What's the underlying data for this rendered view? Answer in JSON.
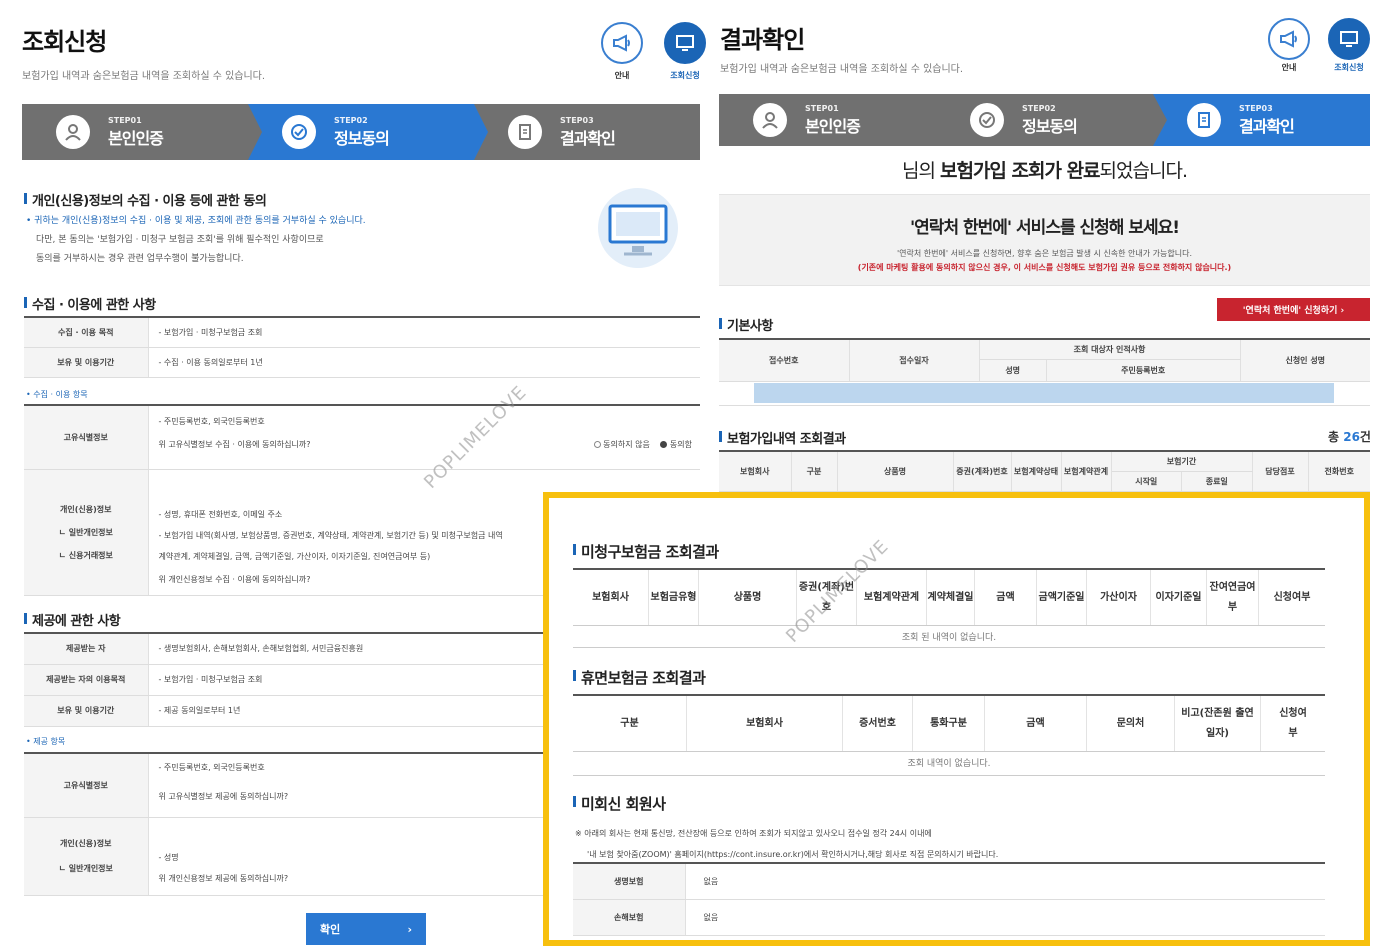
{
  "left": {
    "title": "조회신청",
    "subtitle": "보험가입 내역과 숨은보험금 내역을 조회하실 수 있습니다.",
    "btn_guide": "안내",
    "btn_inquiry": "조회신청",
    "steps": [
      {
        "no": "STEP01",
        "name": "본인인증"
      },
      {
        "no": "STEP02",
        "name": "정보동의"
      },
      {
        "no": "STEP03",
        "name": "결과확인"
      }
    ],
    "consent_title": "개인(신용)정보의 수집 · 이용 등에 관한 동의",
    "consent_lines": [
      "• 귀하는 개인(신용)정보의 수집 · 이용 및 제공, 조회에 관한 동의를 거부하실 수 있습니다.",
      "다만, 본 동의는 '보험가입 · 미청구 보험금 조회'를 위해 필수적인 사항이므로",
      "동의를 거부하시는 경우 관련 업무수행이 불가능합니다."
    ],
    "collect_title": "수집 · 이용에 관한 사항",
    "collect_rows": [
      {
        "label": "수집 · 이용 목적",
        "value": "- 보험가입 · 미청구보험금 조회"
      },
      {
        "label": "보유 및 이용기간",
        "value": "- 수집 · 이용 동의일로부터 1년"
      }
    ],
    "collect_items_label": "• 수집 · 이용 항목",
    "unique_id_label": "고유식별정보",
    "unique_id_value": "- 주민등록번호, 외국인등록번호",
    "unique_id_q": "위 고유식별정보 수집 · 이용에 동의하십니까?",
    "disagree": "동의하지 않음",
    "agree": "동의함",
    "personal_labels": [
      "개인(신용)정보",
      "ㄴ 일반개인정보",
      "ㄴ 신용거래정보"
    ],
    "personal_lines": [
      "- 성명, 휴대폰 전화번호, 이메일 주소",
      "- 보험가입 내역(회사명, 보험상품명, 증권번호, 계약상태, 계약관계, 보험기간 등) 및 미청구보험금 내역",
      "계약관계, 계약체결일, 금액, 금액기준일, 가산이자, 이자기준일, 진여연금여부 등)"
    ],
    "personal_q": "위 개인신용정보 수집 · 이용에 동의하십니까?",
    "provide_title": "제공에 관한 사항",
    "provide_rows": [
      {
        "label": "제공받는 자",
        "value": "- 생명보험회사, 손해보험회사, 손해보험협회, 서민금융진흥원"
      },
      {
        "label": "제공받는 자의 이용목적",
        "value": "- 보험가입 · 미청구보험금 조회"
      },
      {
        "label": "보유 및 이용기간",
        "value": "- 제공 동의일로부터 1년"
      }
    ],
    "provide_items_label": "• 제공 항목",
    "provide_q1": "위 고유식별정보 제공에 동의하십니까?",
    "provide_personal_labels": [
      "개인(신용)정보",
      "ㄴ 일반개인정보"
    ],
    "provide_personal_value": "- 성명",
    "provide_q2": "위 개인신용정보 제공에 동의하십니까?",
    "confirm": "확인"
  },
  "right": {
    "title": "결과확인",
    "subtitle": "보험가입 내역과 숨은보험금 내역을 조회하실 수 있습니다.",
    "btn_guide": "안내",
    "btn_inquiry": "조회신청",
    "steps": [
      {
        "no": "STEP01",
        "name": "본인인증"
      },
      {
        "no": "STEP02",
        "name": "정보동의"
      },
      {
        "no": "STEP03",
        "name": "결과확인"
      }
    ],
    "complete_pre": "님의 ",
    "complete_bold": "보험가입 조회가 완료",
    "complete_post": "되었습니다.",
    "notice_title": "'연락처 한번에' 서비스를 신청해 보세요!",
    "notice_line1": "'연락처 한번에' 서비스를 신청하면, 향후 숨은 보험금 발생 시 신속한 안내가 가능합니다.",
    "notice_line2": "(기존에 마케팅 활용에 동의하지 않으신 경우, 이 서비스를 신청해도 보험가입 권유 등으로 전화하지 않습니다.)",
    "apply_btn": "'연락처 한번에' 신청하기  ›",
    "basic_title": "기본사항",
    "basic_headers": [
      "접수번호",
      "접수일자",
      "조회 대상자 인적사항",
      "성명",
      "주민등록번호",
      "신청인 성명"
    ],
    "join_title": "보험가입내역 조회결과",
    "total_pre": "총 ",
    "total_count": "26",
    "total_post": "건",
    "join_headers": [
      "보험회사",
      "구분",
      "상품명",
      "증권(계좌)번호",
      "보험계약상태",
      "보험계약관계",
      "보험기간",
      "시작일",
      "종료일",
      "담당점포",
      "전화번호"
    ]
  },
  "box": {
    "unclaimed_title": "미청구보험금 조회결과",
    "unclaimed_headers": [
      "보험회사",
      "보험금유형",
      "상품명",
      "증권(계좌)번호",
      "보험계약관계",
      "계약체결일",
      "금액",
      "금액기준일",
      "가산이자",
      "이자기준일",
      "잔여연금여부",
      "신청여부"
    ],
    "unclaimed_empty": "조회 된 내역이 없습니다.",
    "dormant_title": "휴면보험금 조회결과",
    "dormant_headers": [
      "구분",
      "보험회사",
      "증서번호",
      "통화구분",
      "금액",
      "문의처",
      "비고(잔존원 출연일자)",
      "신청여부"
    ],
    "dormant_empty": "조회 내역이 없습니다.",
    "nonmember_title": "미회신 회원사",
    "nonmember_line1": "※ 아래의 회사는 현재 통신망, 전산장애 등으로 인하여 조회가 되지않고 있사오니 접수일 정각 24시 이내에",
    "nonmember_line2": "'내 보험 찾아줌(ZOOM)' 홈페이지(https://cont.insure.or.kr)에서 확인하시거나,해당 회사로 직접 문의하시기 바랍니다.",
    "nonmember_rows": [
      {
        "label": "생명보험",
        "value": "없음"
      },
      {
        "label": "손해보험",
        "value": "없음"
      }
    ]
  },
  "watermark": "POPLIMELOVE",
  "colors": {
    "accent": "#1b65b6",
    "step_blue": "#2a78d2",
    "step_gray": "#707070",
    "gold": "#f7c00e",
    "red": "#c8242f"
  }
}
